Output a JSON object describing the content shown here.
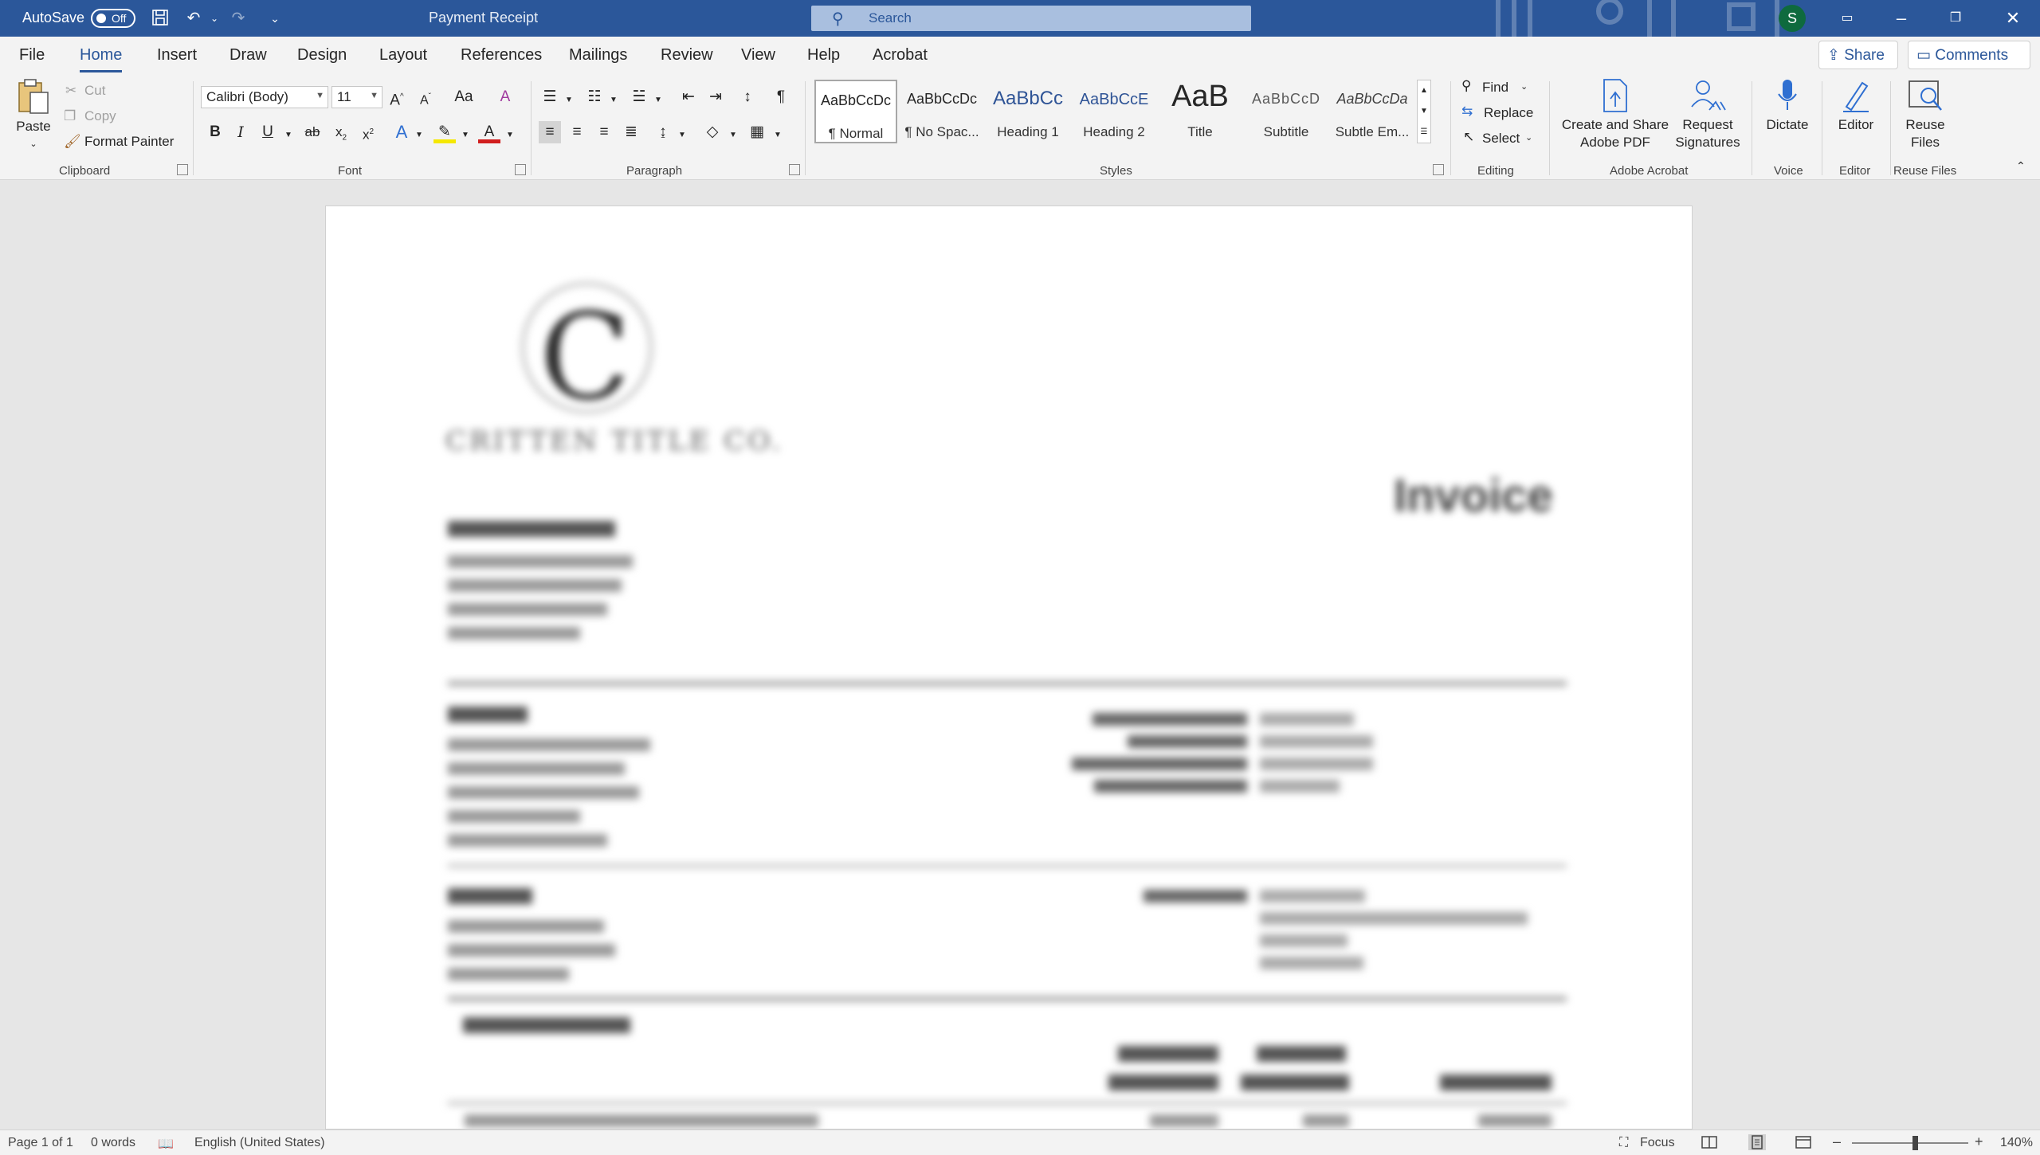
{
  "titlebar": {
    "autosave_label": "AutoSave",
    "autosave_state": "Off",
    "doc_title": "Payment Receipt",
    "search_placeholder": "Search",
    "user_initial": "S"
  },
  "ribbon_tabs": [
    "File",
    "Home",
    "Insert",
    "Draw",
    "Design",
    "Layout",
    "References",
    "Mailings",
    "Review",
    "View",
    "Help",
    "Acrobat"
  ],
  "active_tab": "Home",
  "share_label": "Share",
  "comments_label": "Comments",
  "clipboard": {
    "paste": "Paste",
    "cut": "Cut",
    "copy": "Copy",
    "format_painter": "Format Painter",
    "group": "Clipboard"
  },
  "font": {
    "family": "Calibri (Body)",
    "size": "11",
    "group": "Font"
  },
  "paragraph": {
    "group": "Paragraph"
  },
  "styles": {
    "group": "Styles",
    "items": [
      {
        "sample": "AaBbCcDc",
        "name": "¶ Normal"
      },
      {
        "sample": "AaBbCcDc",
        "name": "¶ No Spac..."
      },
      {
        "sample": "AaBbCc",
        "name": "Heading 1"
      },
      {
        "sample": "AaBbCcE",
        "name": "Heading 2"
      },
      {
        "sample": "AaB",
        "name": "Title"
      },
      {
        "sample": "AaBbCcD",
        "name": "Subtitle"
      },
      {
        "sample": "AaBbCcDa",
        "name": "Subtle Em..."
      }
    ]
  },
  "editing": {
    "find": "Find",
    "replace": "Replace",
    "select": "Select",
    "group": "Editing"
  },
  "acrobat": {
    "create_share_line1": "Create and Share",
    "create_share_line2": "Adobe PDF",
    "request_line1": "Request",
    "request_line2": "Signatures",
    "group": "Adobe Acrobat"
  },
  "voice": {
    "dictate": "Dictate",
    "group": "Voice"
  },
  "editor": {
    "editor": "Editor",
    "group": "Editor"
  },
  "reuse": {
    "line1": "Reuse",
    "line2": "Files",
    "group": "Reuse Files"
  },
  "document": {
    "invoice_title": "Invoice"
  },
  "statusbar": {
    "page": "Page 1 of 1",
    "words": "0 words",
    "language": "English (United States)",
    "focus": "Focus",
    "zoom": "140%"
  }
}
